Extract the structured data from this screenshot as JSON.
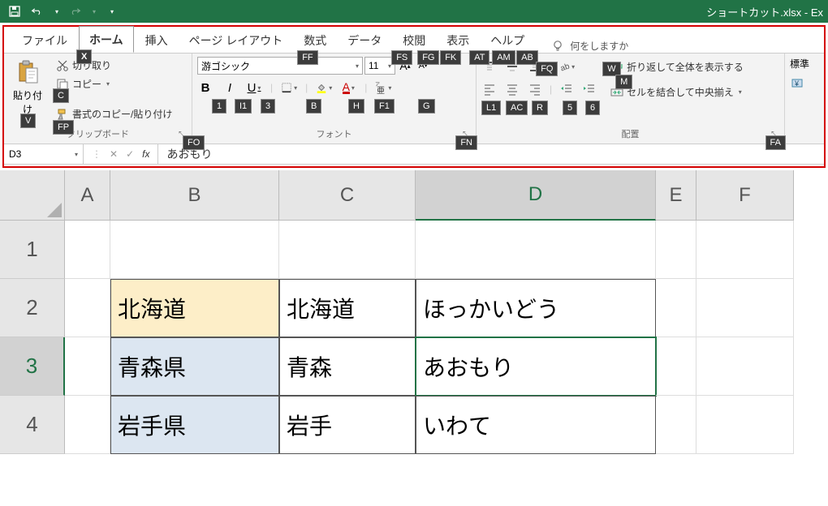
{
  "titlebar": {
    "title": "ショートカット.xlsx - Ex"
  },
  "tabs": {
    "file": "ファイル",
    "home": "ホーム",
    "insert": "挿入",
    "pagelayout": "ページ レイアウト",
    "formulas": "数式",
    "data": "データ",
    "review": "校閲",
    "view": "表示",
    "help": "ヘルプ",
    "tellme": "何をしますか"
  },
  "keytips": {
    "home_x": "X",
    "formulas_ff": "FF",
    "review_fs": "FS",
    "fg": "FG",
    "fk": "FK",
    "at": "AT",
    "am": "AM",
    "ab": "AB",
    "fq": "FQ",
    "w": "W",
    "paste_v": "V",
    "copy_c": "C",
    "fp": "FP",
    "b1": "1",
    "i1": "I1",
    "u3": "3",
    "border_b": "B",
    "fill_h": "H",
    "font_f1": "F1",
    "g": "G",
    "l1": "L1",
    "ac": "AC",
    "r": "R",
    "five": "5",
    "six": "6",
    "m": "M",
    "fo": "FO",
    "fn": "FN",
    "fa": "FA"
  },
  "clipboard": {
    "paste": "貼り付け",
    "cut": "切り取り",
    "copy": "コピー",
    "format_painter": "書式のコピー/貼り付け",
    "label": "クリップボード"
  },
  "font": {
    "name": "游ゴシック",
    "size": "11",
    "label": "フォント"
  },
  "alignment": {
    "wrap": "折り返して全体を表示する",
    "merge": "セルを結合して中央揃え",
    "label": "配置"
  },
  "number": {
    "std": "標準"
  },
  "formula_bar": {
    "cell_ref": "D3",
    "content": "あおもり"
  },
  "sheet": {
    "cols": [
      "A",
      "B",
      "C",
      "D",
      "E",
      "F"
    ],
    "rows": [
      "1",
      "2",
      "3",
      "4"
    ],
    "data": {
      "B2": "北海道",
      "C2": "北海道",
      "D2": "ほっかいどう",
      "B3": "青森県",
      "C3": "青森",
      "D3": "あおもり",
      "B4": "岩手県",
      "C4": "岩手",
      "D4": "いわて"
    }
  }
}
